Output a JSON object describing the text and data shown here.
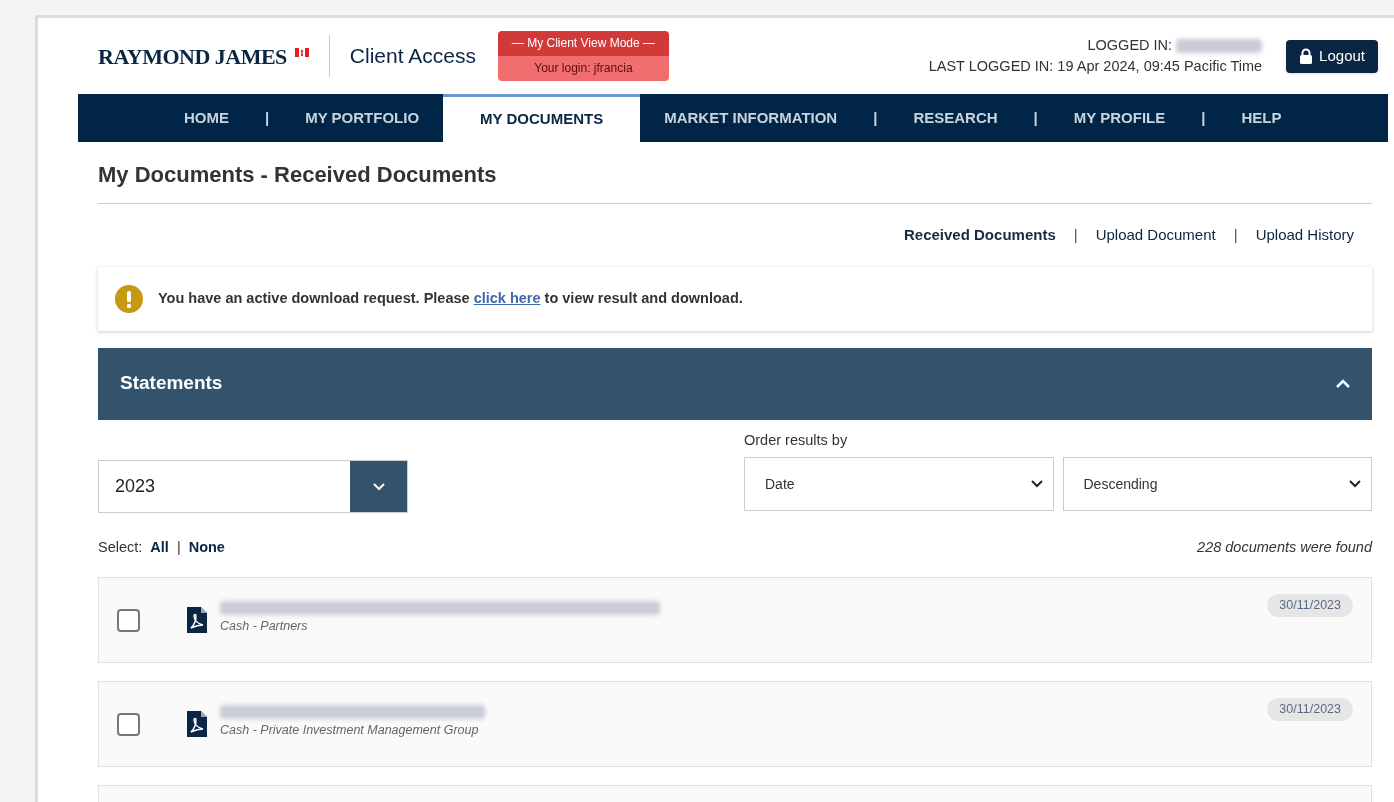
{
  "header": {
    "logo": "RAYMOND JAMES",
    "app_name": "Client Access",
    "view_mode": {
      "title": "— My Client View Mode —",
      "login": "Your login: jfrancia"
    },
    "logged_in_label": "LOGGED IN:",
    "last_logged_in": "LAST LOGGED IN: 19 Apr 2024, 09:45 Pacific Time",
    "logout": "Logout"
  },
  "nav": [
    {
      "kind": "tab",
      "label": "HOME",
      "selected": false
    },
    {
      "kind": "divider",
      "label": "|"
    },
    {
      "kind": "tab",
      "label": "MY PORTFOLIO",
      "selected": false
    },
    {
      "kind": "tab",
      "label": "MY DOCUMENTS",
      "selected": true
    },
    {
      "kind": "tab",
      "label": "MARKET INFORMATION",
      "selected": false
    },
    {
      "kind": "divider",
      "label": "|"
    },
    {
      "kind": "tab",
      "label": "RESEARCH",
      "selected": false
    },
    {
      "kind": "divider",
      "label": "|"
    },
    {
      "kind": "tab",
      "label": "MY PROFILE",
      "selected": false
    },
    {
      "kind": "divider",
      "label": "|"
    },
    {
      "kind": "tab",
      "label": "HELP",
      "selected": false
    }
  ],
  "page_title": "My Documents - Received Documents",
  "subnav": [
    {
      "kind": "link",
      "label": "Received Documents",
      "selected": true
    },
    {
      "kind": "divider",
      "label": "|"
    },
    {
      "kind": "link",
      "label": "Upload Document",
      "selected": false
    },
    {
      "kind": "divider",
      "label": "|"
    },
    {
      "kind": "link",
      "label": "Upload History",
      "selected": false
    }
  ],
  "alert": {
    "before": "You have an active download request. Please ",
    "link": "click here",
    "after": " to view result and download."
  },
  "section": {
    "title": "Statements",
    "expanded": true
  },
  "year_select": {
    "value": "2023"
  },
  "order_label": "Order results by",
  "order_field": {
    "value": "Date"
  },
  "order_direction": {
    "value": "Descending"
  },
  "select": {
    "label": "Select:",
    "all": "All",
    "divider": "|",
    "none": "None"
  },
  "found": "228 documents were found",
  "documents": [
    {
      "category": "Cash - Partners",
      "date": "30/11/2023",
      "checked": false
    },
    {
      "category": "Cash - Private Investment Management Group",
      "date": "30/11/2023",
      "checked": false
    }
  ]
}
